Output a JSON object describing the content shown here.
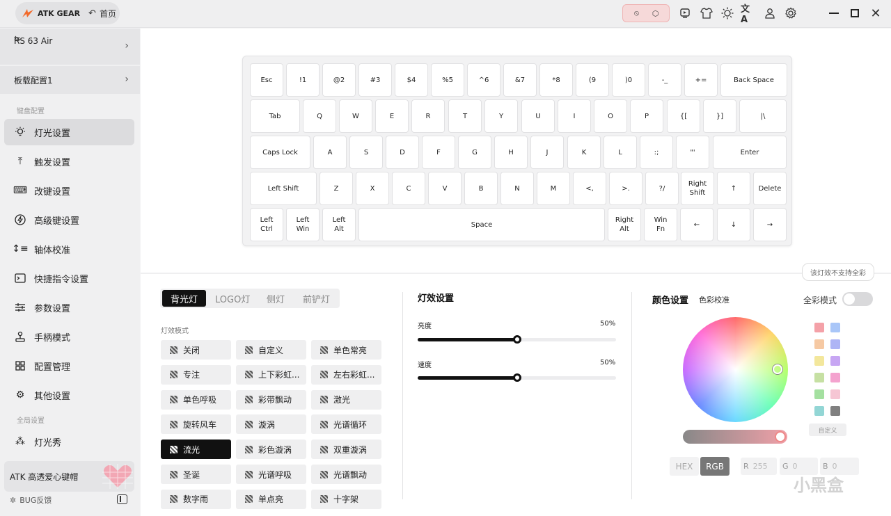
{
  "titlebar": {
    "brand": "ATK GEAR",
    "home": "首页",
    "icons": [
      "block-icon",
      "cube-icon",
      "screen-icon",
      "shirt-icon",
      "brightness-icon",
      "translate-icon",
      "user-icon",
      "settings-icon",
      "minimize-icon",
      "maximize-icon",
      "close-icon"
    ]
  },
  "device": {
    "name": "RS 63 Air"
  },
  "profile": {
    "name": "板载配置1"
  },
  "sidebar": {
    "group_keyboard": "键盘配置",
    "group_global": "全局设置",
    "items": [
      {
        "label": "灯光设置",
        "icon": "lightbulb-icon"
      },
      {
        "label": "触发设置",
        "icon": "trigger-icon"
      },
      {
        "label": "改键设置",
        "icon": "keyboard-icon"
      },
      {
        "label": "高级键设置",
        "icon": "lightning-icon"
      },
      {
        "label": "轴体校准",
        "icon": "calibrate-icon"
      },
      {
        "label": "快捷指令设置",
        "icon": "terminal-icon"
      },
      {
        "label": "参数设置",
        "icon": "sliders-icon"
      },
      {
        "label": "手柄模式",
        "icon": "joystick-icon"
      },
      {
        "label": "配置管理",
        "icon": "grid-icon"
      },
      {
        "label": "其他设置",
        "icon": "gear-icon"
      },
      {
        "label": "灯光秀",
        "icon": "lightshow-icon"
      }
    ],
    "promo": "ATK 高透爱心键帽",
    "bug": "BUG反馈"
  },
  "keyboard": {
    "rows": [
      [
        "Esc",
        "!1",
        "@2",
        "#3",
        "$4",
        "%5",
        "^6",
        "&7",
        "*8",
        "(9",
        ")0",
        "-_",
        "+=",
        "Back Space"
      ],
      [
        "Tab",
        "Q",
        "W",
        "E",
        "R",
        "T",
        "Y",
        "U",
        "I",
        "O",
        "P",
        "{[",
        "}]",
        "|\\"
      ],
      [
        "Caps Lock",
        "A",
        "S",
        "D",
        "F",
        "G",
        "H",
        "J",
        "K",
        "L",
        ":;",
        "\"'",
        "Enter"
      ],
      [
        "Left Shift",
        "Z",
        "X",
        "C",
        "V",
        "B",
        "N",
        "M",
        "<,",
        ">.",
        "?/",
        "Right\nShift",
        "↑",
        "Delete"
      ],
      [
        "Left\nCtrl",
        "Left\nWin",
        "Left\nAlt",
        "Space",
        "Right\nAlt",
        "Win\nFn",
        "←",
        "↓",
        "→"
      ]
    ]
  },
  "light_tabs": [
    "背光灯",
    "LOGO灯",
    "侧灯",
    "前铲灯"
  ],
  "effect_mode_label": "灯效模式",
  "effects": [
    "关闭",
    "自定义",
    "单色常亮",
    "专注",
    "上下彩虹...",
    "左右彩虹...",
    "单色呼吸",
    "彩带飘动",
    "激光",
    "旋转风车",
    "漩涡",
    "光谱循环",
    "流光",
    "彩色漩涡",
    "双重漩涡",
    "圣诞",
    "光谱呼吸",
    "光谱飘动",
    "数字雨",
    "单点亮",
    "十字架"
  ],
  "effect_selected": "流光",
  "effect_settings": {
    "title": "灯效设置",
    "brightness_label": "亮度",
    "brightness": "50%",
    "brightness_value": 0.5,
    "speed_label": "速度",
    "speed": "50%",
    "speed_value": 0.5
  },
  "color": {
    "title": "颜色设置",
    "calibrate": "色彩校准",
    "full_color": "全彩模式",
    "tooltip": "该灯效不支持全彩",
    "custom": "自定义",
    "hex": "HEX",
    "rgb": "RGB",
    "r": "R",
    "g": "G",
    "b": "B",
    "r_val": "255",
    "g_val": "0",
    "b_val": "0",
    "swatches": [
      "#f4a1a8",
      "#a9c6f8",
      "#f6c9a3",
      "#aeb5f5",
      "#f3e79c",
      "#c7a6f3",
      "#c6e0a3",
      "#f4a3cf",
      "#a4e0a0",
      "#f6c6d4",
      "#93d6d5",
      "#808080"
    ]
  },
  "watermark": "小黑盒"
}
